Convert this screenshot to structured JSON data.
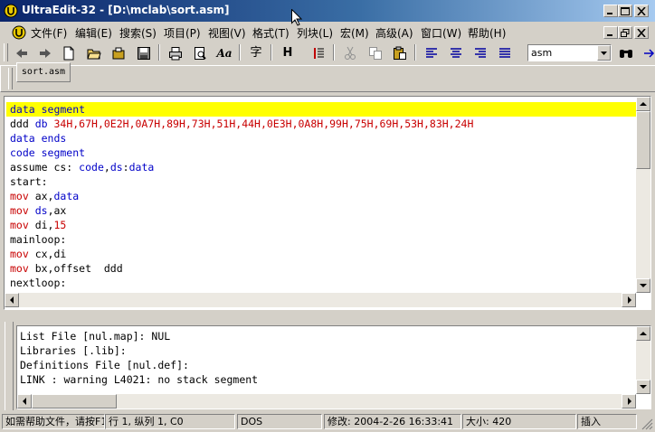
{
  "window": {
    "title": "UltraEdit-32 - [D:\\mclab\\sort.asm]",
    "colors": {
      "titlebar_start": "#0a246a",
      "titlebar_end": "#a6caf0"
    }
  },
  "menu": {
    "items": [
      {
        "label": "文件(F)"
      },
      {
        "label": "编辑(E)"
      },
      {
        "label": "搜索(S)"
      },
      {
        "label": "项目(P)"
      },
      {
        "label": "视图(V)"
      },
      {
        "label": "格式(T)"
      },
      {
        "label": "列块(L)"
      },
      {
        "label": "宏(M)"
      },
      {
        "label": "高级(A)"
      },
      {
        "label": "窗口(W)"
      },
      {
        "label": "帮助(H)"
      }
    ]
  },
  "toolbar": {
    "icons": [
      "back-icon",
      "forward-icon",
      "new-file-icon",
      "open-file-icon",
      "open-folder-icon",
      "save-icon",
      "print-icon",
      "print-preview-icon",
      "font-icon",
      "word-wrap-icon",
      "hex-mode-icon",
      "column-marker-icon",
      "cut-icon",
      "copy-icon",
      "paste-icon",
      "align-left-icon",
      "align-center-icon",
      "align-right-icon",
      "justify-icon",
      "find-icon"
    ],
    "font_label": "Aa",
    "wrap_label": "字",
    "hex_label": "H",
    "syntax_value": "asm"
  },
  "tabs": [
    {
      "label": "sort.asm"
    }
  ],
  "editor": {
    "colors": {
      "keyword": "#0000c8",
      "operand": "#c80000",
      "highlight": "#ffff00"
    },
    "lines": [
      {
        "parts": [
          {
            "t": "data segment",
            "c": "kw"
          }
        ],
        "hl": true
      },
      {
        "parts": [
          {
            "t": "ddd ",
            "c": ""
          },
          {
            "t": "db ",
            "c": "kw"
          },
          {
            "t": "34H,67H,0E2H,0A7H,89H,73H,51H,44H,0E3H,0A8H,99H,75H,69H,53H,83H,24H",
            "c": "num"
          }
        ]
      },
      {
        "parts": [
          {
            "t": "data ends",
            "c": "kw"
          }
        ]
      },
      {
        "parts": [
          {
            "t": "code segment",
            "c": "kw"
          }
        ]
      },
      {
        "parts": [
          {
            "t": "assume cs: ",
            "c": ""
          },
          {
            "t": "code",
            "c": "kw"
          },
          {
            "t": ",",
            "c": ""
          },
          {
            "t": "ds",
            "c": "kw"
          },
          {
            "t": ":",
            "c": ""
          },
          {
            "t": "data",
            "c": "kw"
          }
        ]
      },
      {
        "parts": [
          {
            "t": "start:",
            "c": ""
          }
        ]
      },
      {
        "parts": [
          {
            "t": "mov ",
            "c": "op"
          },
          {
            "t": "ax,",
            "c": ""
          },
          {
            "t": "data",
            "c": "kw"
          }
        ]
      },
      {
        "parts": [
          {
            "t": "mov ",
            "c": "op"
          },
          {
            "t": "ds",
            "c": "kw"
          },
          {
            "t": ",ax",
            "c": ""
          }
        ]
      },
      {
        "parts": [
          {
            "t": "mov ",
            "c": "op"
          },
          {
            "t": "di,",
            "c": ""
          },
          {
            "t": "15",
            "c": "num"
          }
        ]
      },
      {
        "parts": [
          {
            "t": "mainloop:",
            "c": ""
          }
        ]
      },
      {
        "parts": [
          {
            "t": "mov ",
            "c": "op"
          },
          {
            "t": "cx,di",
            "c": ""
          }
        ]
      },
      {
        "parts": [
          {
            "t": "mov ",
            "c": "op"
          },
          {
            "t": "bx,offset  ddd",
            "c": ""
          }
        ]
      },
      {
        "parts": [
          {
            "t": "nextloop:",
            "c": ""
          }
        ]
      }
    ]
  },
  "output": {
    "lines": [
      "List File [nul.map]: NUL",
      "Libraries [.lib]:",
      "Definitions File [nul.def]:",
      "LINK : warning L4021: no stack segment"
    ]
  },
  "status": {
    "help": "如需帮助文件，请按F1",
    "position": "行 1, 纵列 1, C0",
    "format": "DOS",
    "modified": "修改: 2004-2-26 16:33:41",
    "size": "大小: 420",
    "mode": "插入"
  }
}
